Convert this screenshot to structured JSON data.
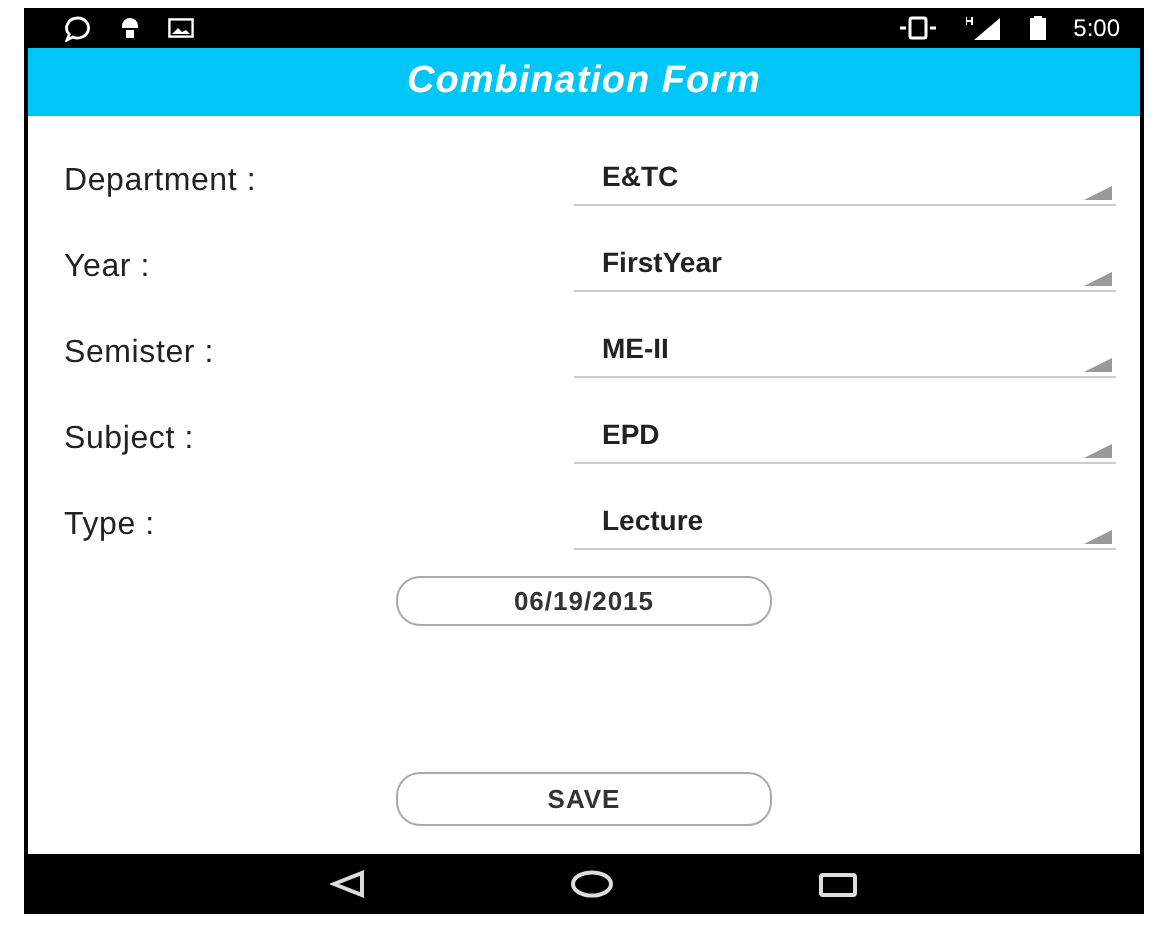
{
  "status_bar": {
    "time": "5:00"
  },
  "title": "Combination Form",
  "fields": [
    {
      "label": "Department :",
      "value": "E&TC"
    },
    {
      "label": "Year :",
      "value": "FirstYear"
    },
    {
      "label": "Semister :",
      "value": "ME-II"
    },
    {
      "label": "Subject :",
      "value": "EPD"
    },
    {
      "label": "Type :",
      "value": "Lecture"
    }
  ],
  "date_button": "06/19/2015",
  "save_button": "SAVE"
}
